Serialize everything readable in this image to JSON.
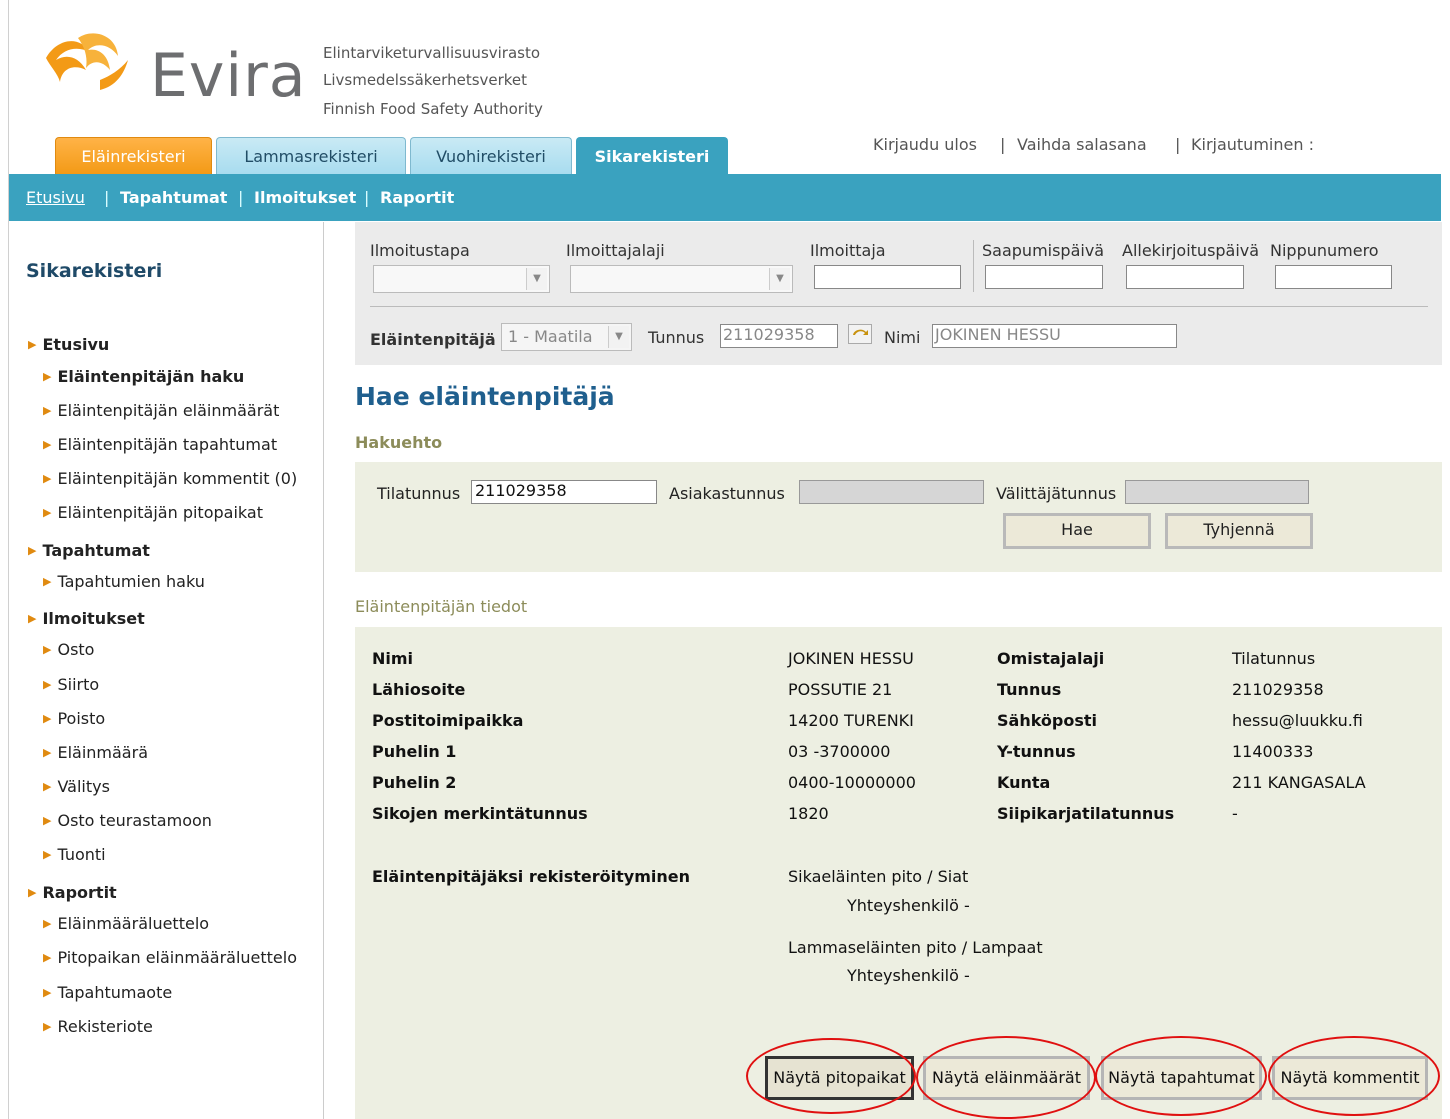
{
  "header": {
    "logo_text": "Evira",
    "agency_lines": [
      "Elintarviketurvallisuusvirasto",
      "Livsmedelssäkerhetsverket",
      "Finnish Food Safety Authority"
    ],
    "top_links": {
      "logout": "Kirjaudu ulos",
      "change_password": "Vaihda salasana",
      "login_label": "Kirjautuminen :"
    },
    "tabs": [
      "Eläinrekisteri",
      "Lammasrekisteri",
      "Vuohirekisteri",
      "Sikarekisteri"
    ],
    "nav": [
      "Etusivu",
      "Tapahtumat",
      "Ilmoitukset",
      "Raportit"
    ]
  },
  "sidebar": {
    "title": "Sikarekisteri",
    "items": [
      {
        "label": "Etusivu"
      },
      {
        "label": "Eläintenpitäjän haku"
      },
      {
        "label": "Eläintenpitäjän eläinmäärät"
      },
      {
        "label": "Eläintenpitäjän tapahtumat"
      },
      {
        "label": "Eläintenpitäjän kommentit (0)"
      },
      {
        "label": "Eläintenpitäjän pitopaikat"
      },
      {
        "label": "Tapahtumat"
      },
      {
        "label": "Tapahtumien haku"
      },
      {
        "label": "Ilmoitukset"
      },
      {
        "label": "Osto"
      },
      {
        "label": "Siirto"
      },
      {
        "label": "Poisto"
      },
      {
        "label": "Eläinmäärä"
      },
      {
        "label": "Välitys"
      },
      {
        "label": "Osto teurastamoon"
      },
      {
        "label": "Tuonti"
      },
      {
        "label": "Raportit"
      },
      {
        "label": "Eläinmääräluettelo"
      },
      {
        "label": "Pitopaikan eläinmääräluettelo"
      },
      {
        "label": "Tapahtumaote"
      },
      {
        "label": "Rekisteriote"
      }
    ]
  },
  "topform": {
    "labels": {
      "ilmoitustapa": "Ilmoitustapa",
      "ilmoittajalaji": "Ilmoittajalaji",
      "ilmoittaja": "Ilmoittaja",
      "saapumispaiva": "Saapumispäivä",
      "allekirjoituspaiva": "Allekirjoituspäivä",
      "nippunumero": "Nippunumero",
      "elaintenpitaja": "Eläintenpitäjä :",
      "tunnus": "Tunnus",
      "nimi": "Nimi"
    },
    "elaintenpitaja_select": "1 - Maatila",
    "tunnus_value": "211029358",
    "nimi_value": "JOKINEN HESSU"
  },
  "page": {
    "title": "Hae eläintenpitäjä",
    "search_heading": "Hakuehto",
    "search": {
      "tilatunnus_label": "Tilatunnus",
      "tilatunnus_value": "211029358",
      "asiakastunnus_label": "Asiakastunnus",
      "valittajatunnus_label": "Välittäjätunnus",
      "search_button": "Hae",
      "clear_button": "Tyhjennä"
    },
    "info_heading": "Eläintenpitäjän tiedot",
    "info": {
      "left_labels": [
        "Nimi",
        "Lähiosoite",
        "Postitoimipaikka",
        "Puhelin 1",
        "Puhelin 2",
        "Sikojen merkintätunnus"
      ],
      "left_values": [
        "JOKINEN HESSU",
        "POSSUTIE 21",
        "14200 TURENKI",
        "03 -3700000",
        "0400-10000000",
        "1820"
      ],
      "right_labels": [
        "Omistajalaji",
        "Tunnus",
        "Sähköposti",
        "Y-tunnus",
        "Kunta",
        "Siipikarjatilatunnus"
      ],
      "right_values": [
        "Tilatunnus",
        "211029358",
        "hessu@luukku.fi",
        "11400333",
        "211 KANGASALA",
        "-"
      ],
      "registration_label": "Eläintenpitäjäksi rekisteröityminen",
      "registrations": [
        {
          "type": "Sikaeläinten pito / Siat",
          "contact": "Yhteyshenkilö -"
        },
        {
          "type": "Lammaseläinten pito / Lampaat",
          "contact": "Yhteyshenkilö -"
        }
      ]
    },
    "bottom_buttons": [
      "Näytä pitopaikat",
      "Näytä eläinmäärät",
      "Näytä tapahtumat",
      "Näytä kommentit"
    ]
  },
  "colors": {
    "nav_bg": "#3aa2bf",
    "orange_tab": "#f39a16",
    "panel_bg": "#edefe2",
    "title_blue": "#1f5f8e",
    "annotation_red": "#e01010"
  }
}
